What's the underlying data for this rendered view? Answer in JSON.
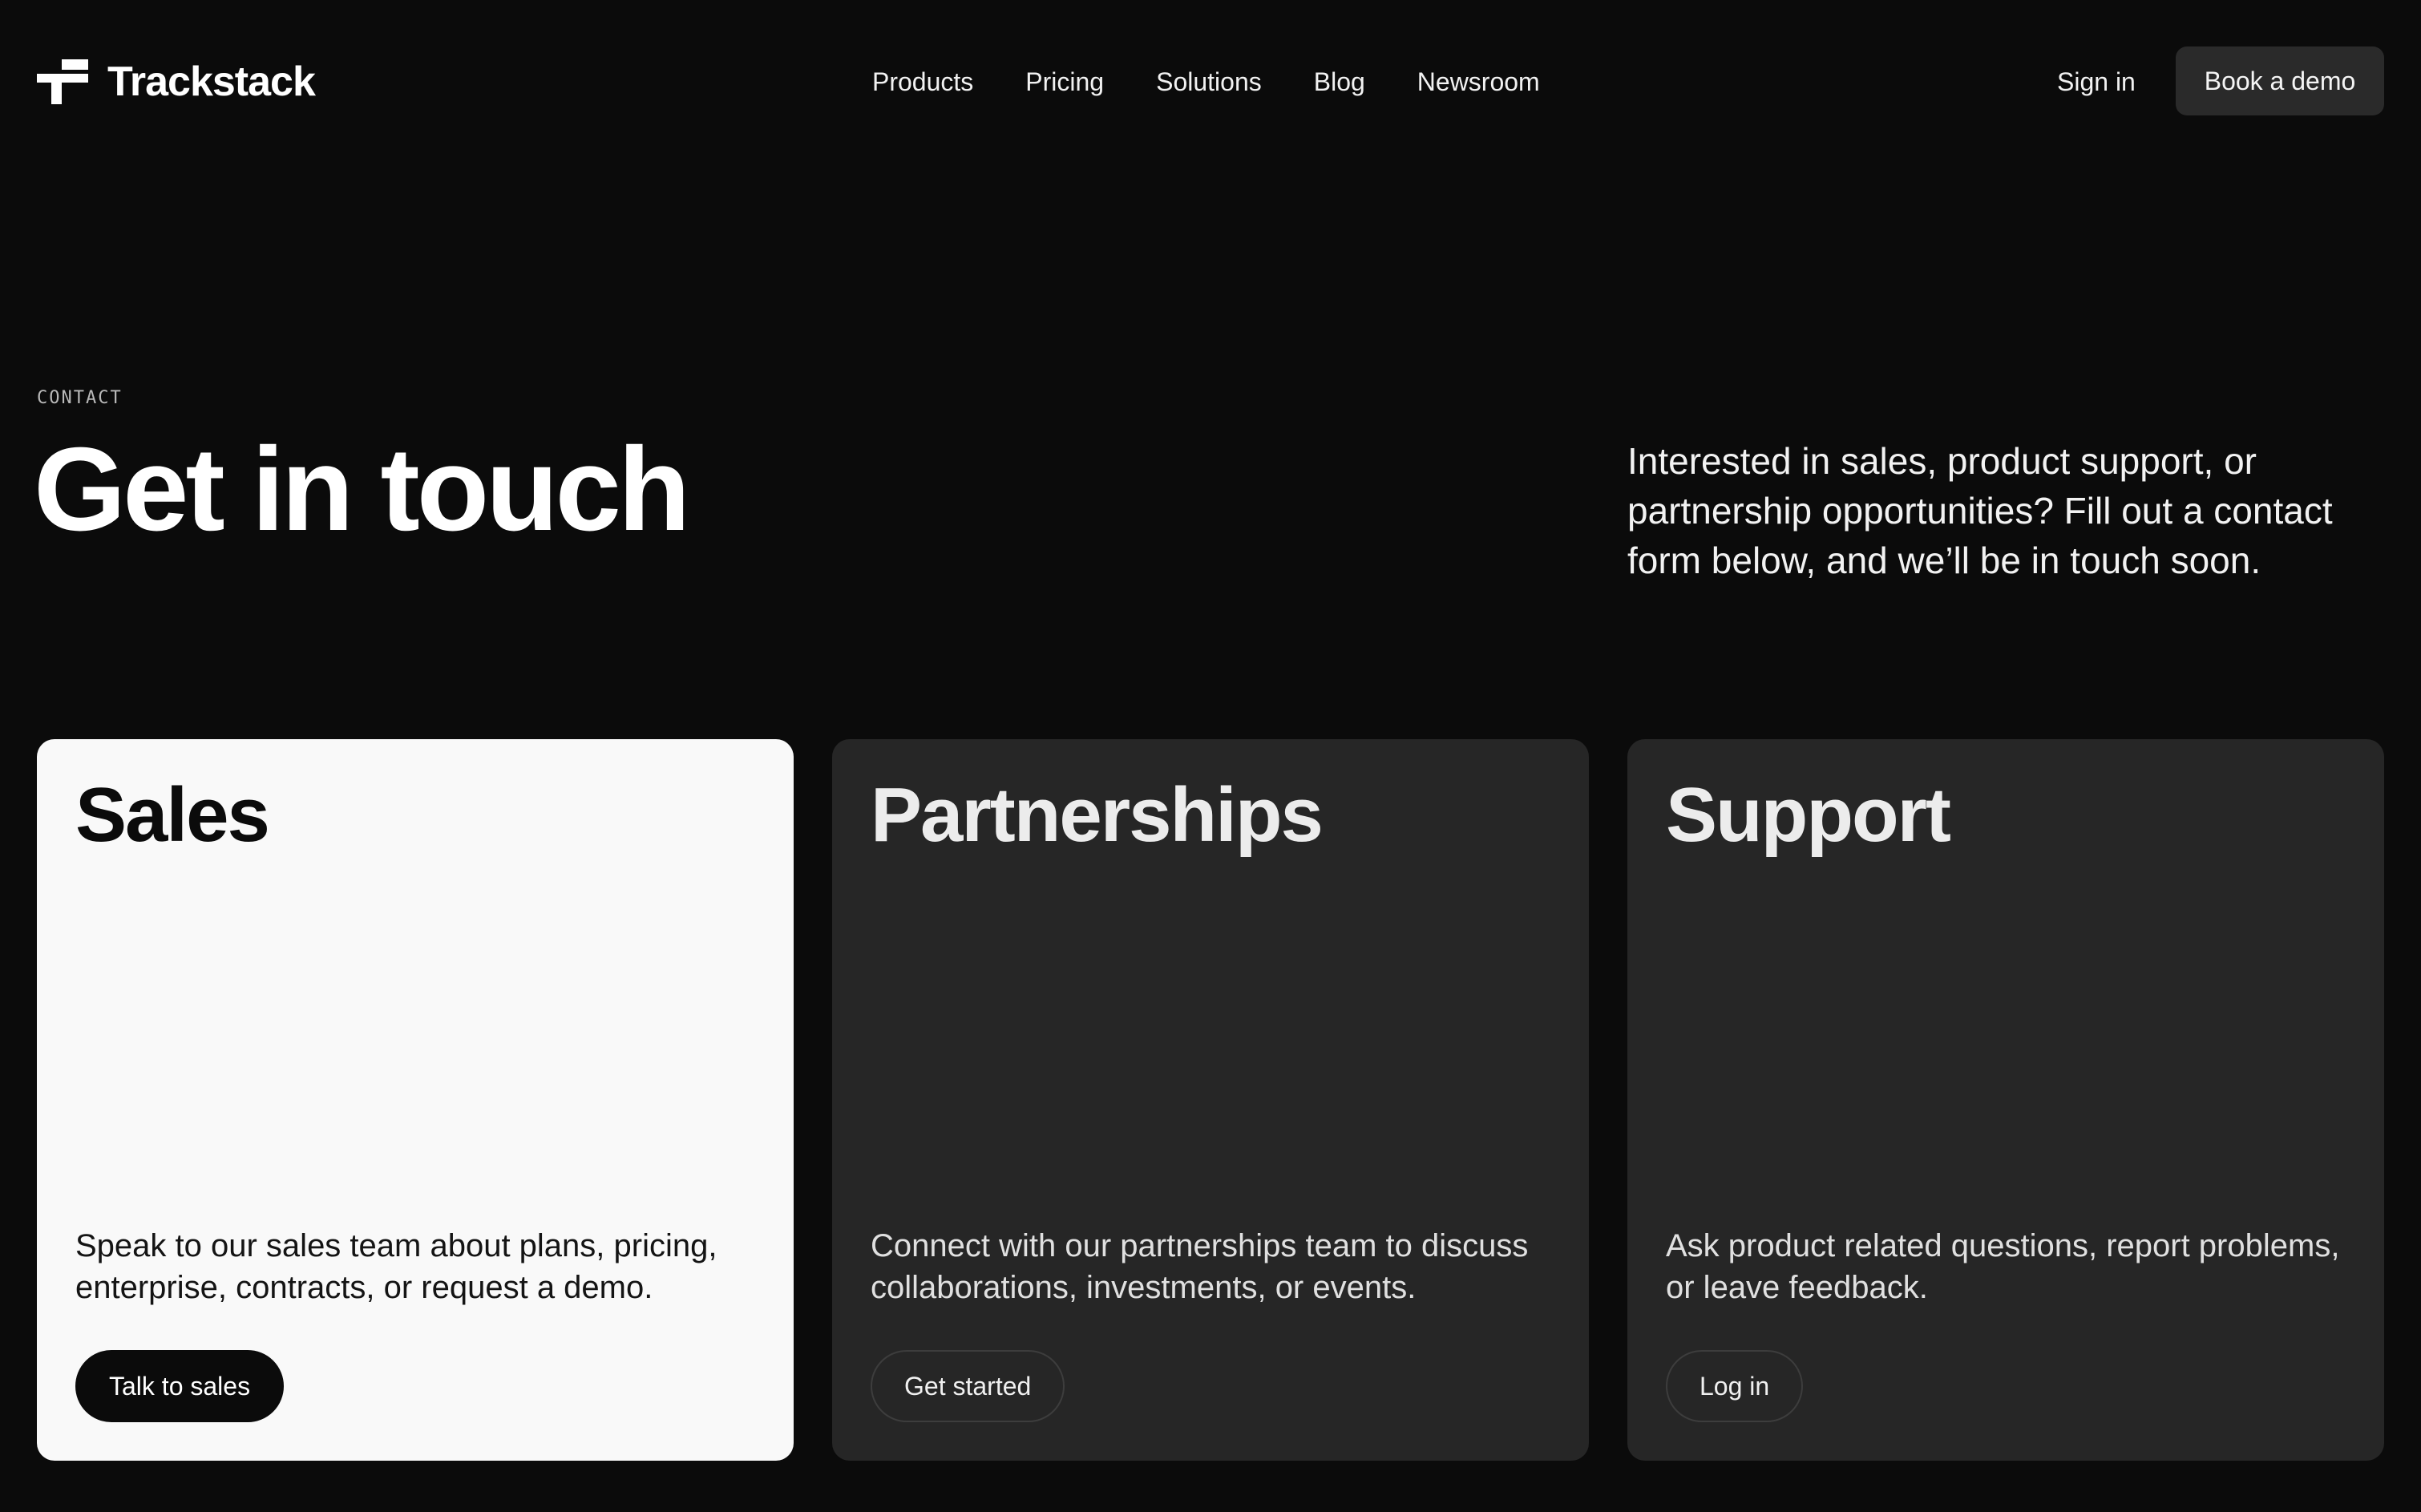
{
  "header": {
    "brand": "Trackstack",
    "nav": [
      "Products",
      "Pricing",
      "Solutions",
      "Blog",
      "Newsroom"
    ],
    "sign_in": "Sign in",
    "book_demo": "Book a demo"
  },
  "hero": {
    "eyebrow": "CONTACT",
    "title": "Get in touch",
    "description": "Interested in sales, product support, or partnership opportunities? Fill out a contact form below, and we’ll be in touch soon."
  },
  "cards": [
    {
      "title": "Sales",
      "description": "Speak to our sales team about plans, pricing, enterprise, contracts, or request a demo.",
      "button": "Talk to sales"
    },
    {
      "title": "Partnerships",
      "description": "Connect with our partnerships team to discuss collaborations, investments, or events.",
      "button": "Get started"
    },
    {
      "title": "Support",
      "description": "Ask product related questions, report problems, or leave feedback.",
      "button": "Log in"
    }
  ],
  "colors": {
    "page_background": "#0b0b0b",
    "card_dark": "#262626",
    "card_light": "#f9f9f9",
    "button_dark": "#2a2a2a"
  },
  "icons": {
    "brand_logo": "trackstack-logo-icon"
  }
}
